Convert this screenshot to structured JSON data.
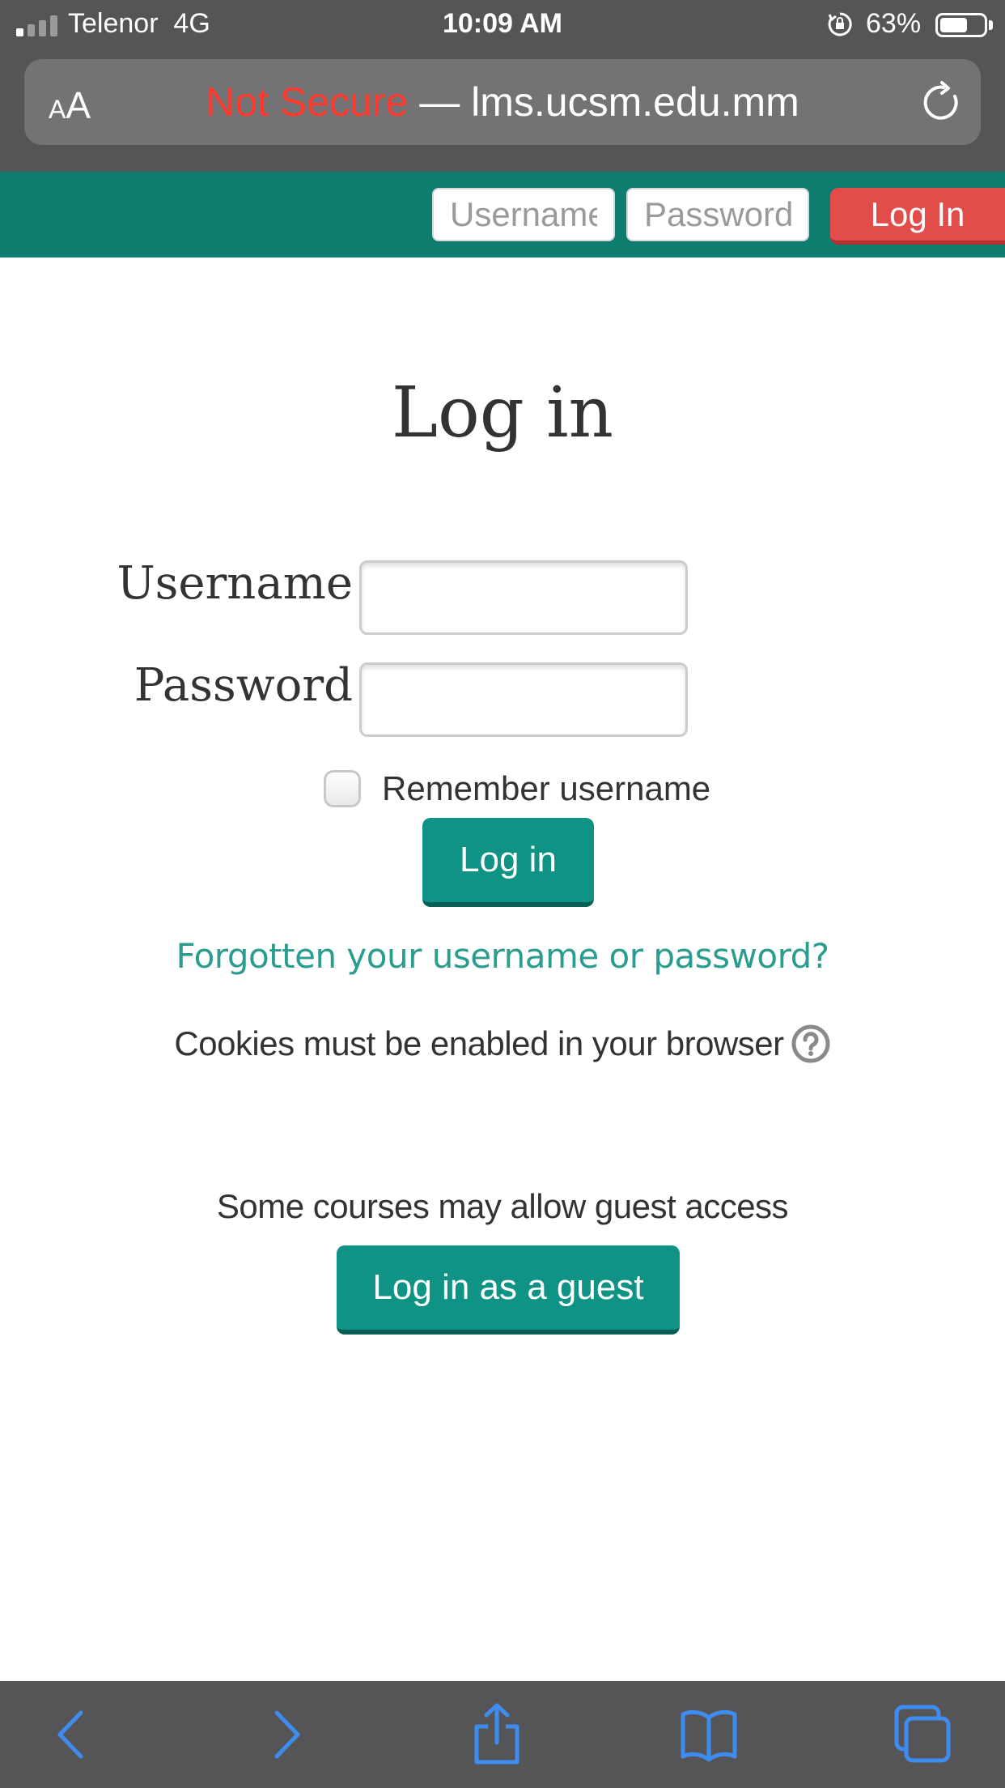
{
  "status_bar": {
    "carrier": "Telenor",
    "network": "4G",
    "time": "10:09 AM",
    "battery": "63%",
    "battery_level": 0.63
  },
  "browser": {
    "text_size_label_small": "A",
    "text_size_label_large": "A",
    "security_warning": "Not Secure",
    "separator": " — ",
    "domain": "lms.ucsm.edu.mm",
    "accent_color": "#ff3b30"
  },
  "navbar": {
    "username_placeholder": "Username",
    "password_placeholder": "Password",
    "login_button": "Log In",
    "bg_color": "#0e7d6f",
    "login_color": "#e24d49"
  },
  "login_form": {
    "title": "Log in",
    "username_label": "Username",
    "username_value": "",
    "password_label": "Password",
    "password_value": "",
    "remember_label": "Remember username",
    "remember_checked": false,
    "submit_button": "Log in",
    "forgot_link": "Forgotten your username or password?",
    "cookies_note": "Cookies must be enabled in your browser",
    "guest_note": "Some courses may allow guest access",
    "guest_button": "Log in as a guest",
    "accent_color": "#0e9384"
  },
  "toolbar": {
    "icons": [
      "back-icon",
      "forward-icon",
      "share-icon",
      "bookmarks-icon",
      "tabs-icon"
    ],
    "icon_color": "#3f8cf0"
  }
}
